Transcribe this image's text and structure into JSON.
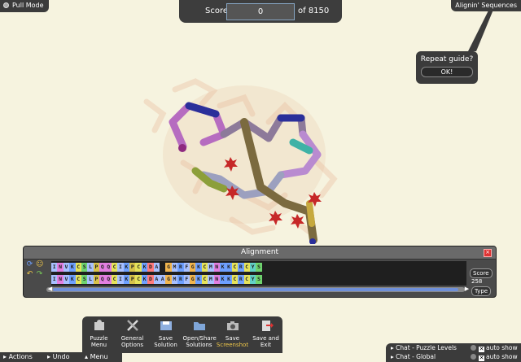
{
  "top_left": {
    "pull_mode_label": "Pull Mode"
  },
  "top_right": {
    "title": "Alignin' Sequences"
  },
  "score": {
    "label": "Score:",
    "value": "0",
    "of_label": "of 8150"
  },
  "guide": {
    "question": "Repeat guide?",
    "ok_label": "OK!"
  },
  "alignment": {
    "title": "Alignment",
    "row1": [
      "I",
      "N",
      "V",
      "K",
      "C",
      "S",
      "L",
      "P",
      "Q",
      "Q",
      "C",
      "I",
      "K",
      "P",
      "C",
      "K",
      "D",
      "A",
      "",
      "G",
      "M",
      "R",
      "F",
      "G",
      "K",
      "C",
      "M",
      "N",
      "K",
      "K",
      "C",
      "R",
      "C",
      "Y",
      "S"
    ],
    "row2": [
      "I",
      "N",
      "V",
      "K",
      "C",
      "S",
      "L",
      "P",
      "Q",
      "Q",
      "C",
      "I",
      "K",
      "P",
      "C",
      "K",
      "D",
      "A",
      "A",
      "G",
      "M",
      "R",
      "F",
      "G",
      "K",
      "C",
      "M",
      "N",
      "K",
      "K",
      "C",
      "R",
      "C",
      "Y",
      "S"
    ],
    "score_button": "Score",
    "score_value": "258",
    "type_button": "Type"
  },
  "residue_colors": {
    "I": "#a8c0ff",
    "N": "#e27fe0",
    "V": "#a8c0ff",
    "K": "#6ea0ff",
    "C": "#e6e35a",
    "S": "#6fd36f",
    "L": "#a8c0ff",
    "P": "#d7c24a",
    "Q": "#e27fe0",
    "D": "#ff7b7b",
    "A": "#a8c0ff",
    "G": "#f1b54e",
    "M": "#a8c0ff",
    "R": "#6ea0ff",
    "F": "#a8c0ff",
    "Y": "#62d0c8"
  },
  "menu": {
    "items": [
      {
        "label1": "Puzzle",
        "label2": "Menu"
      },
      {
        "label1": "General",
        "label2": "Options"
      },
      {
        "label1": "Save",
        "label2": "Solution"
      },
      {
        "label1": "Open/Share",
        "label2": "Solutions"
      },
      {
        "label1": "Save",
        "label2": "Screenshot"
      },
      {
        "label1": "Save and",
        "label2": "Exit"
      }
    ]
  },
  "bottom": {
    "actions": "Actions",
    "undo": "Undo",
    "menu": "Menu"
  },
  "chat": {
    "puzzle_levels": "Chat - Puzzle Levels",
    "global": "Chat - Global",
    "auto_show": "auto show"
  }
}
